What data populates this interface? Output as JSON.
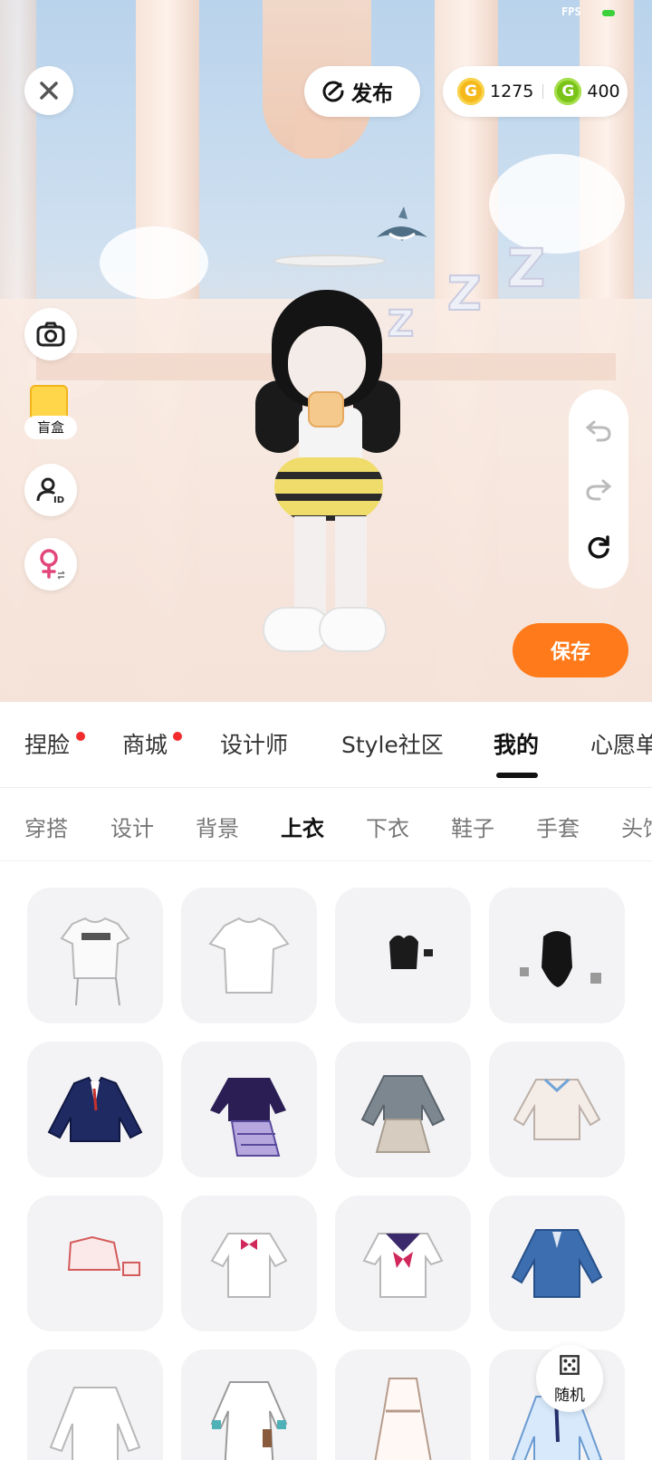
{
  "status": {
    "fps_label": "FPS"
  },
  "header": {
    "publish_label": "发布",
    "gold_coins": "1275",
    "green_coins": "400"
  },
  "side_tools": {
    "blind_box_label": "盲盒"
  },
  "save_label": "保存",
  "main_tabs": [
    {
      "label": "捏脸",
      "badge": true
    },
    {
      "label": "商城",
      "badge": true
    },
    {
      "label": "设计师",
      "badge": false
    },
    {
      "label": "Style社区",
      "badge": false
    },
    {
      "label": "我的",
      "active": true
    },
    {
      "label": "心愿单"
    }
  ],
  "sub_tabs": [
    {
      "label": "穿搭"
    },
    {
      "label": "设计"
    },
    {
      "label": "背景"
    },
    {
      "label": "上衣",
      "active": true
    },
    {
      "label": "下衣"
    },
    {
      "label": "鞋子"
    },
    {
      "label": "手套"
    },
    {
      "label": "头饰"
    }
  ],
  "items": [
    {
      "icon": "white-graphic-tee-icon"
    },
    {
      "icon": "white-tshirt-icon"
    },
    {
      "icon": "black-bow-top-icon"
    },
    {
      "icon": "black-bodysuit-icon"
    },
    {
      "icon": "navy-blazer-icon"
    },
    {
      "icon": "purple-plaid-dress-icon"
    },
    {
      "icon": "grey-uniform-dress-icon"
    },
    {
      "icon": "white-cardigan-icon"
    },
    {
      "icon": "pink-crop-top-icon"
    },
    {
      "icon": "white-bow-shirt-icon"
    },
    {
      "icon": "sailor-shirt-icon"
    },
    {
      "icon": "blue-jacket-icon"
    },
    {
      "icon": "white-blouse-icon"
    },
    {
      "icon": "white-belted-dress-icon"
    },
    {
      "icon": "long-white-dress-icon"
    },
    {
      "icon": "light-blue-uniform-icon"
    }
  ],
  "random_label": "随机",
  "colors": {
    "accent": "#ff7a1a",
    "badge": "#f22c2c",
    "gold": "#f6b91b",
    "green": "#7ac318"
  }
}
